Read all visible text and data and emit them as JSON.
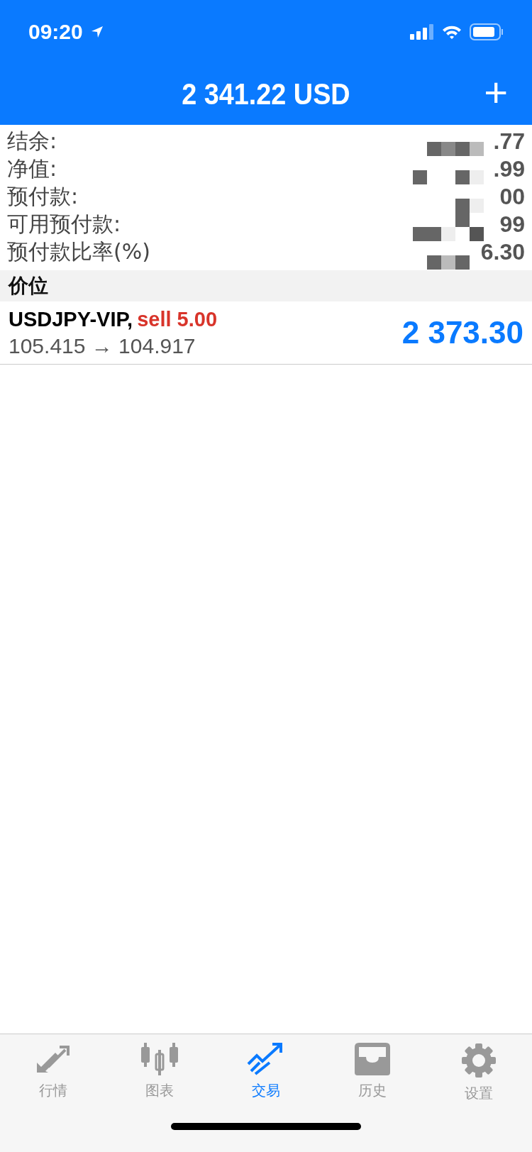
{
  "status_bar": {
    "time": "09:20"
  },
  "header": {
    "title": "2 341.22 USD",
    "add": "+"
  },
  "summary": [
    {
      "label": "结余:",
      "value": ".77"
    },
    {
      "label": "净值:",
      "value": ".99"
    },
    {
      "label": "预付款:",
      "value": "00"
    },
    {
      "label": "可用预付款:",
      "value": "99"
    },
    {
      "label": "预付款比率(%)",
      "value": "6.30"
    }
  ],
  "section": {
    "title": "价位"
  },
  "positions": [
    {
      "symbol": "USDJPY-VIP,",
      "trade": "sell 5.00",
      "prices": "105.415 → 104.917",
      "profit": "2 373.30"
    }
  ],
  "tab_bar": [
    {
      "label": "行情",
      "kind": "quotes",
      "selected": false
    },
    {
      "label": "图表",
      "kind": "chart",
      "selected": false
    },
    {
      "label": "交易",
      "kind": "trade",
      "selected": true
    },
    {
      "label": "历史",
      "kind": "history",
      "selected": false
    },
    {
      "label": "设置",
      "kind": "settings",
      "selected": false
    }
  ]
}
